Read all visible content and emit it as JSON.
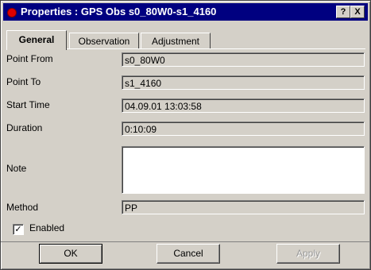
{
  "window": {
    "title": "Properties : GPS Obs s0_80W0-s1_4160",
    "help_label": "?",
    "close_label": "X"
  },
  "tabs": [
    {
      "label": "General",
      "active": true
    },
    {
      "label": "Observation",
      "active": false
    },
    {
      "label": "Adjustment",
      "active": false
    }
  ],
  "fields": {
    "point_from": {
      "label": "Point From",
      "value": "s0_80W0"
    },
    "point_to": {
      "label": "Point To",
      "value": "s1_4160"
    },
    "start_time": {
      "label": "Start Time",
      "value": "04.09.01 13:03:58"
    },
    "duration": {
      "label": "Duration",
      "value": "0:10:09"
    },
    "note": {
      "label": "Note",
      "value": ""
    },
    "method": {
      "label": "Method",
      "value": "PP"
    }
  },
  "enabled": {
    "label": "Enabled",
    "checked": true,
    "mark": "✓"
  },
  "buttons": {
    "ok": "OK",
    "cancel": "Cancel",
    "apply": "Apply"
  },
  "colors": {
    "titlebar": "#000080",
    "face": "#d4d0c8",
    "title_icon": "#e00000"
  }
}
